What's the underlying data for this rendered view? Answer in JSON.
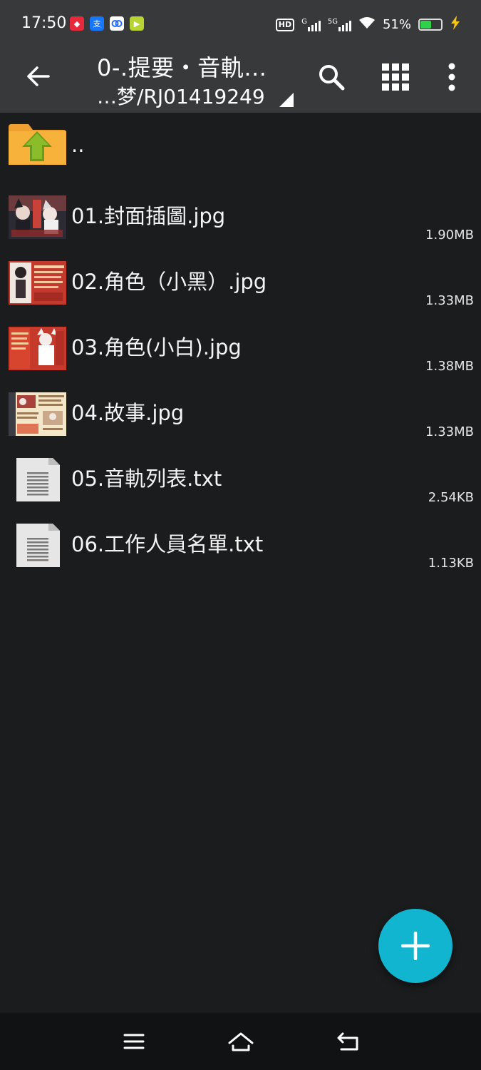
{
  "status_bar": {
    "time": "17:50",
    "hd_label": "HD",
    "network_1": "G",
    "network_2": "5G",
    "battery_text": "51%",
    "battery_level": 0.51,
    "colors": {
      "battery_fill": "#2fd14a",
      "charging": "#f5c518"
    }
  },
  "toolbar": {
    "title": "0-.提要・音軌…",
    "path": "…梦/RJ01419249",
    "icons": [
      "back-arrow-icon",
      "search-icon",
      "grid-view-icon",
      "more-vert-icon"
    ]
  },
  "files": [
    {
      "name": "..",
      "size": "",
      "type": "parent",
      "icon": "folder-up-icon"
    },
    {
      "name": "01.封面插圖.jpg",
      "size": "1.90MB",
      "type": "image",
      "icon": "image-thumbnail"
    },
    {
      "name": "02.角色（小黑）.jpg",
      "size": "1.33MB",
      "type": "image",
      "icon": "image-thumbnail"
    },
    {
      "name": "03.角色(小白).jpg",
      "size": "1.38MB",
      "type": "image",
      "icon": "image-thumbnail"
    },
    {
      "name": "04.故事.jpg",
      "size": "1.33MB",
      "type": "image",
      "icon": "image-thumbnail"
    },
    {
      "name": "05.音軌列表.txt",
      "size": "2.54KB",
      "type": "text",
      "icon": "text-file-icon"
    },
    {
      "name": "06.工作人員名單.txt",
      "size": "1.13KB",
      "type": "text",
      "icon": "text-file-icon"
    }
  ],
  "fab": {
    "icon": "plus-icon",
    "color": "#12b5cf"
  },
  "nav_bar": {
    "icons": [
      "menu-icon",
      "home-icon",
      "back-icon"
    ]
  }
}
